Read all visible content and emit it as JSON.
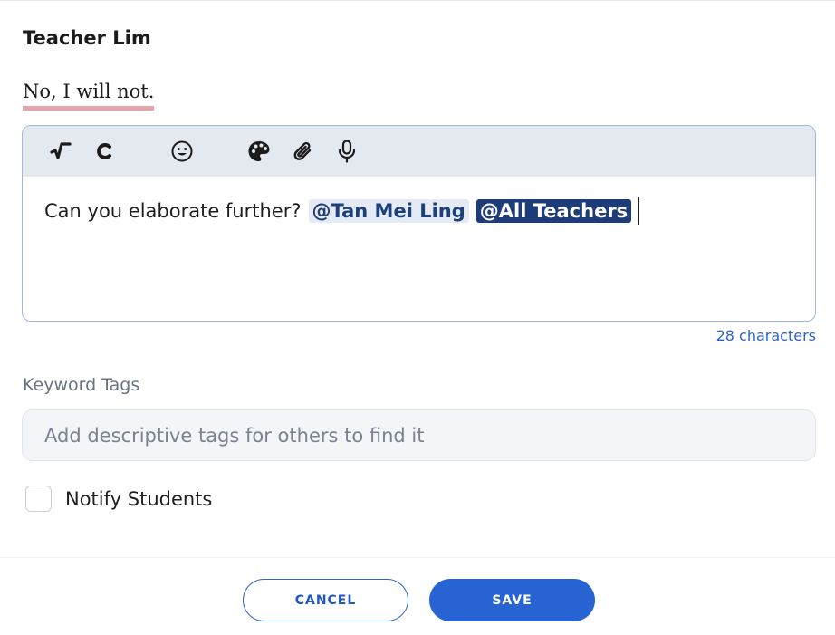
{
  "comment": {
    "author": "Teacher Lim",
    "quoted_text": "No, I will not."
  },
  "editor": {
    "toolbar_icons": [
      "formula-icon",
      "chemistry-icon",
      "emoji-icon",
      "palette-icon",
      "attachment-icon",
      "microphone-icon"
    ],
    "body_text": "Can you elaborate further?",
    "mentions": [
      {
        "label": "@Tan Mei Ling",
        "selected": false
      },
      {
        "label": "@All Teachers",
        "selected": true
      }
    ],
    "char_count": "28 characters"
  },
  "keyword_tags": {
    "label": "Keyword Tags",
    "placeholder": "Add descriptive tags for others to find it",
    "value": ""
  },
  "notify": {
    "label": "Notify Students",
    "checked": false
  },
  "actions": {
    "cancel_label": "CANCEL",
    "save_label": "SAVE"
  },
  "colors": {
    "primary": "#2763d2",
    "mention_bg": "#e4ebf5",
    "mention_selected_bg": "#1e3c78",
    "quote_underline": "#e3a6aa",
    "toolbar_bg": "#e4e8ef"
  }
}
